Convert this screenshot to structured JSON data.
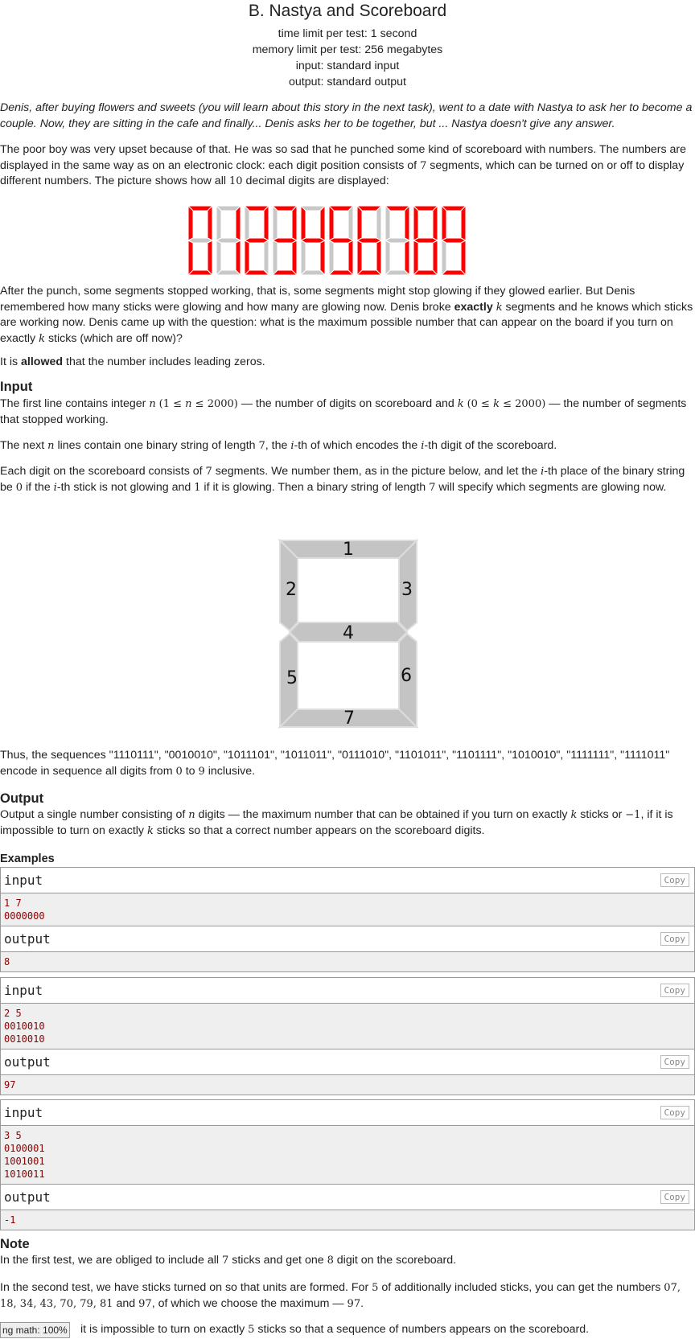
{
  "header": {
    "title": "B. Nastya and Scoreboard",
    "time_limit": "time limit per test: 1 second",
    "memory_limit": "memory limit per test: 256 megabytes",
    "input": "input: standard input",
    "output": "output: standard output"
  },
  "intro_italic": "Denis, after buying flowers and sweets (you will learn about this story in the next task), went to a date with Nastya to ask her to become a couple. Now, they are sitting in the cafe and finally... Denis asks her to be together, but ... Nastya doesn't give any answer.",
  "para1": {
    "a": "The poor boy was very upset because of that. He was so sad that he punched some kind of scoreboard with numbers. The numbers are displayed in the same way as on an electronic clock: each digit position consists of ",
    "seven": "7",
    "b": " segments, which can be turned on or off to display different numbers. The picture shows how all ",
    "ten": "10",
    "c": " decimal digits are displayed:"
  },
  "digit_colors": {
    "on": "#ff0000",
    "off": "#c8c8c8"
  },
  "digits_shown": [
    "0",
    "1",
    "2",
    "3",
    "4",
    "5",
    "6",
    "7",
    "8",
    "9"
  ],
  "para2": {
    "a": "After the punch, some segments stopped working, that is, some segments might stop glowing if they glowed earlier. But Denis remembered how many sticks were glowing and how many are glowing now. Denis broke ",
    "exactly": "exactly",
    "k1": "k",
    "b": " segments and he knows which sticks are working now. Denis came up with the question: what is the maximum possible number that can appear on the board if you turn on exactly ",
    "k2": "k",
    "c": " sticks (which are off now)?"
  },
  "para3": {
    "a": "It is ",
    "allowed": "allowed",
    "b": " that the number includes leading zeros."
  },
  "input_section": {
    "heading": "Input",
    "p1a": "The first line contains integer ",
    "n": "n",
    "p1b": "(1 ≤ ",
    "n2": "n",
    "p1c": " ≤ 2000)",
    "p1d": " — the number of digits on scoreboard and ",
    "k": "k",
    "p1e": "(0 ≤ ",
    "k2": "k",
    "p1f": " ≤ 2000)",
    "p1g": " — the number of segments that stopped working.",
    "p2a": "The next ",
    "p2n": "n",
    "p2b": " lines contain one binary string of length ",
    "p2seven": "7",
    "p2c": ", the ",
    "p2i": "i",
    "p2d": "-th of which encodes the ",
    "p2i2": "i",
    "p2e": "-th digit of the scoreboard.",
    "p3a": "Each digit on the scoreboard consists of ",
    "p3seven": "7",
    "p3b": " segments. We number them, as in the picture below, and let the ",
    "p3i": "i",
    "p3c": "-th place of the binary string be ",
    "p3zero": "0",
    "p3d": " if the ",
    "p3i2": "i",
    "p3e": "-th stick is not glowing and ",
    "p3one": "1",
    "p3f": " if it is glowing. Then a binary string of length ",
    "p3seven2": "7",
    "p3g": " will specify which segments are glowing now."
  },
  "segment_labels": [
    "1",
    "2",
    "3",
    "4",
    "5",
    "6",
    "7"
  ],
  "sequences": {
    "a": "Thus, the sequences \"1110111\", \"0010010\", \"1011101\", \"1011011\", \"0111010\", \"1101011\", \"1101111\", \"1010010\", \"1111111\", \"1111011\" encode in sequence all digits from ",
    "zero": "0",
    "to": " to ",
    "nine": "9",
    "b": " inclusive."
  },
  "output_section": {
    "heading": "Output",
    "a": "Output a single number consisting of ",
    "n": "n",
    "b": " digits  — the maximum number that can be obtained if you turn on exactly ",
    "k": "k",
    "c": " sticks or ",
    "minus": "−1",
    "d": ", if it is impossible to turn on exactly ",
    "k2": "k",
    "e": " sticks so that a correct number appears on the scoreboard digits."
  },
  "examples": {
    "heading": "Examples",
    "input_label": "input",
    "output_label": "output",
    "copy_label": "Copy",
    "items": [
      {
        "input": "1 7\n0000000",
        "output": "8"
      },
      {
        "input": "2 5\n0010010\n0010010",
        "output": "97"
      },
      {
        "input": "3 5\n0100001\n1001001\n1010011",
        "output": "-1"
      }
    ]
  },
  "note": {
    "heading": "Note",
    "p1a": "In the first test, we are obliged to include all ",
    "p1seven": "7",
    "p1b": " sticks and get one ",
    "p1eight": "8",
    "p1c": " digit on the scoreboard.",
    "p2a": "In the second test, we have sticks turned on so that units are formed. For ",
    "p2five": "5",
    "p2b": " of additionally included sticks, you can get the numbers ",
    "p2nums": "07, 18, 34, 43, 70, 79, 81",
    "p2c": " and ",
    "p2nine7": "97",
    "p2d": ", of which we choose the maximum  — ",
    "p2max": "97",
    "p2e": ".",
    "p3": "it is impossible to turn on exactly ",
    "p3five": "5",
    "p3b": " sticks so that a sequence of numbers appears on the scoreboard."
  },
  "zoom_badge": "ng math: 100%"
}
